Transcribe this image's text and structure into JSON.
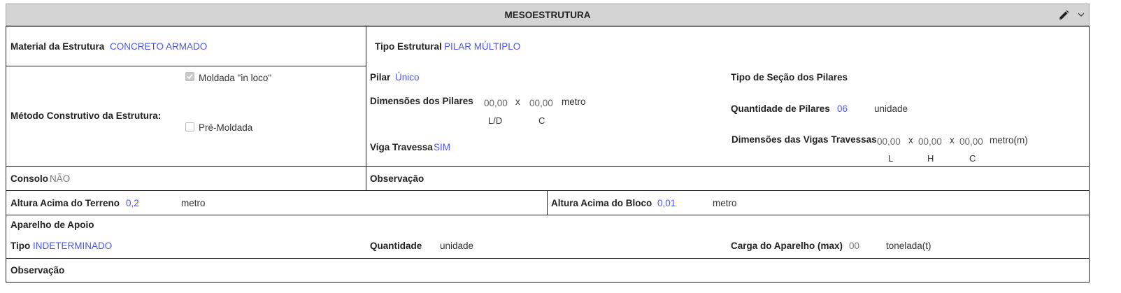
{
  "header": {
    "title": "MESOESTRUTURA",
    "edit_icon": "pencil-icon",
    "collapse_icon": "chevron-down-icon"
  },
  "row1": {
    "material_label": "Material da Estrutura",
    "material_value": "CONCRETO ARMADO",
    "tipo_label": "Tipo Estrutural",
    "tipo_value": "PILAR MÚLTIPLO"
  },
  "metodo": {
    "label": "Método Construtivo da Estrutura:",
    "options": [
      {
        "label": "Moldada \"in loco\"",
        "checked": true,
        "disabled": true
      },
      {
        "label": "Pré-Moldada",
        "checked": false,
        "disabled": true
      }
    ]
  },
  "pilar": {
    "pilar_label": "Pilar",
    "pilar_value": "Único",
    "dim_label": "Dimensões dos Pilares",
    "dim_ld": "00,00",
    "dim_sep": "x",
    "dim_c": "00,00",
    "dim_unit": "metro",
    "dim_sub_ld": "L/D",
    "dim_sub_c": "C",
    "viga_label": "Viga Travessa",
    "viga_value": "SIM"
  },
  "secao": {
    "tipo_secao_label": "Tipo de Seção dos Pilares",
    "qtd_label": "Quantidade de Pilares",
    "qtd_value": "06",
    "qtd_unit": "unidade",
    "vigas_label": "Dimensões das Vigas Travessas",
    "vigas_l": "00,00",
    "vigas_h": "00,00",
    "vigas_c": "00,00",
    "vigas_sep": "x",
    "vigas_unit": "metro(m)",
    "vigas_sub_l": "L",
    "vigas_sub_h": "H",
    "vigas_sub_c": "C"
  },
  "row3": {
    "consolo_label": "Consolo",
    "consolo_value": "NÃO",
    "obs_label": "Observação"
  },
  "row4": {
    "terreno_label": "Altura Acima do Terreno",
    "terreno_value": "0,2",
    "terreno_unit": "metro",
    "bloco_label": "Altura Acima do Bloco",
    "bloco_value": "0,01",
    "bloco_unit": "metro"
  },
  "aparelho": {
    "title": "Aparelho de Apoio",
    "tipo_label": "Tipo",
    "tipo_value": "INDETERMINADO",
    "qtd_label": "Quantidade",
    "qtd_unit": "unidade",
    "carga_label": "Carga do Aparelho (max)",
    "carga_value": "00",
    "carga_unit": "tonelada(t)"
  },
  "footer": {
    "obs_label": "Observação"
  },
  "colors": {
    "value_blue": "#4a57e6",
    "header_bg": "#d4d4d4"
  }
}
